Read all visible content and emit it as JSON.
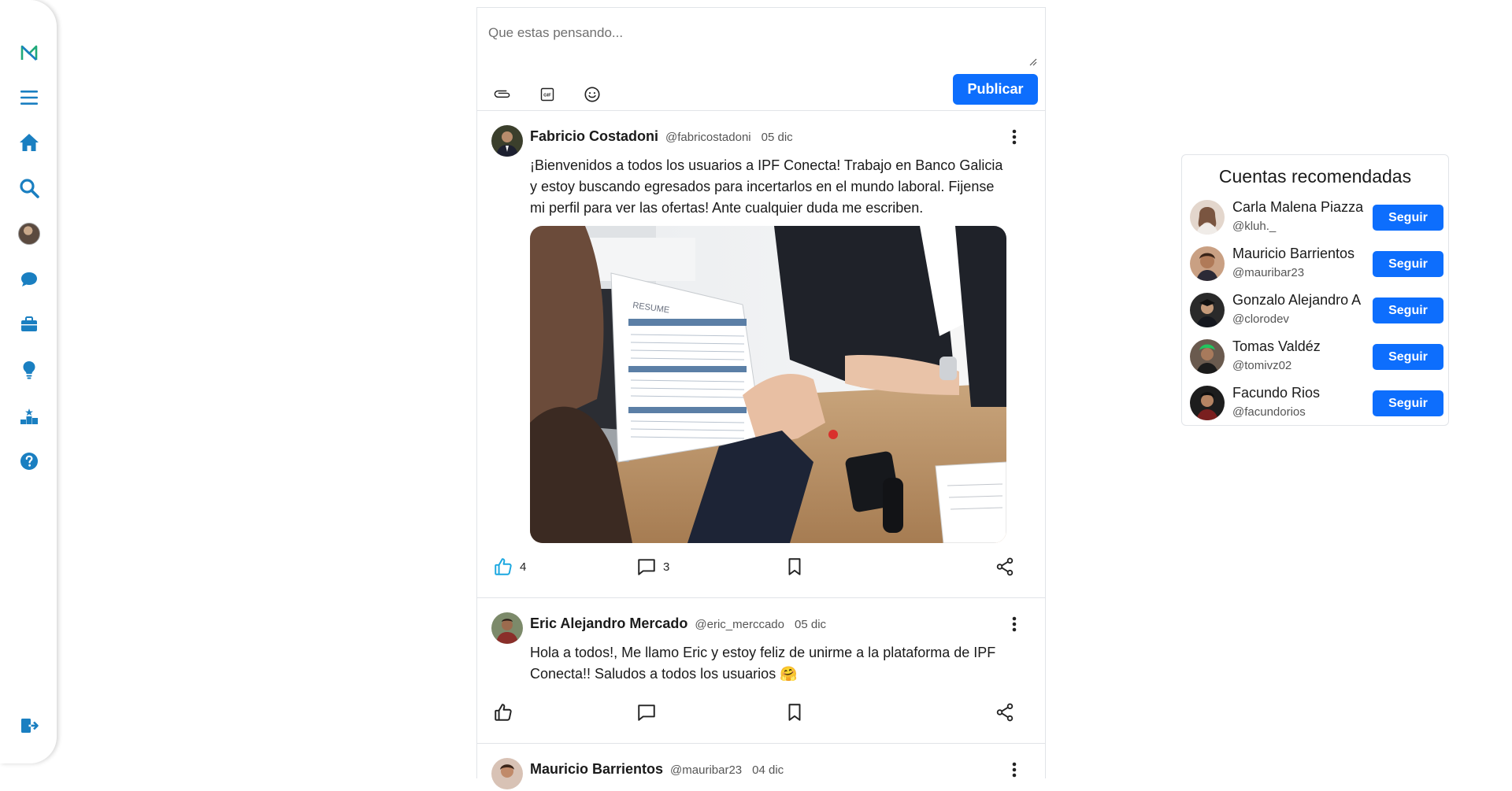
{
  "sidebar": {
    "items": [
      {
        "name": "logo",
        "icon": "logo-icon"
      },
      {
        "name": "menu",
        "icon": "menu-icon"
      },
      {
        "name": "home",
        "icon": "home-icon"
      },
      {
        "name": "search",
        "icon": "search-icon"
      },
      {
        "name": "profile",
        "icon": "avatar"
      },
      {
        "name": "messages",
        "icon": "chat-icon"
      },
      {
        "name": "jobs",
        "icon": "briefcase-icon"
      },
      {
        "name": "ideas",
        "icon": "lightbulb-icon"
      },
      {
        "name": "ranking",
        "icon": "podium-icon"
      },
      {
        "name": "help",
        "icon": "help-icon"
      },
      {
        "name": "logout",
        "icon": "logout-icon"
      }
    ],
    "accent": "#1a7fc1"
  },
  "composer": {
    "placeholder": "Que estas pensando...",
    "tools": [
      "attachment-icon",
      "gif-icon",
      "emoji-icon"
    ],
    "publish_label": "Publicar"
  },
  "posts": [
    {
      "name": "Fabricio Costadoni",
      "handle": "@fabricostadoni",
      "date": "05 dic",
      "text": "¡Bienvenidos a todos los usuarios a IPF Conecta! Trabajo en Banco Galicia y estoy buscando egresados para incertarlos en el mundo laboral. Fijense mi perfil para ver las ofertas! Ante cualquier duda me escriben.",
      "likes": "4",
      "comments": "3",
      "liked": true
    },
    {
      "name": "Eric Alejandro Mercado",
      "handle": "@eric_merccado",
      "date": "05 dic",
      "text": "Hola a todos!, Me llamo Eric y estoy feliz de unirme a la plataforma de IPF Conecta!! Saludos a todos los usuarios 🤗",
      "likes": "",
      "comments": "",
      "liked": false
    },
    {
      "name": "Mauricio Barrientos",
      "handle": "@mauribar23",
      "date": "04 dic"
    }
  ],
  "recommended": {
    "title": "Cuentas recomendadas",
    "follow_label": "Seguir",
    "accounts": [
      {
        "name": "Carla Malena Piazza",
        "handle": "@kluh._"
      },
      {
        "name": "Mauricio Barrientos",
        "handle": "@mauribar23"
      },
      {
        "name": "Gonzalo Alejandro A",
        "handle": "@clorodev"
      },
      {
        "name": "Tomas Valdéz",
        "handle": "@tomivz02"
      },
      {
        "name": "Facundo Rios",
        "handle": "@facundorios"
      }
    ]
  },
  "colors": {
    "primary": "#0d6efd",
    "like_active": "#1aa7e0"
  }
}
